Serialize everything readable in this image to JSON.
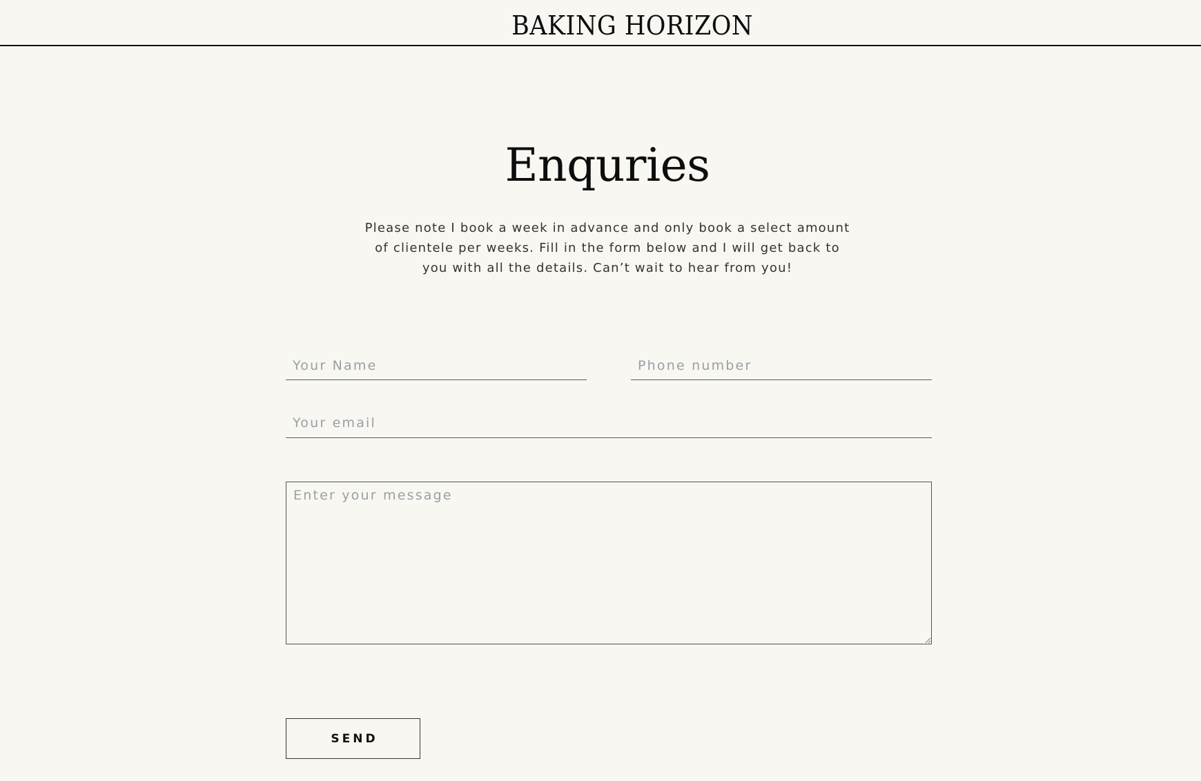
{
  "header": {
    "logo_text": "BAKING HORIZON"
  },
  "main": {
    "title": "Enquries",
    "intro_lines": [
      "Please note I book a week in advance and only book a select amount",
      "of clientele per weeks. Fill in the form below and I will get back to",
      "you with all the details. Can’t wait to hear from you!"
    ]
  },
  "form": {
    "name": {
      "value": "",
      "placeholder": "Your Name"
    },
    "phone": {
      "value": "",
      "placeholder": "Phone number"
    },
    "email": {
      "value": "",
      "placeholder": "Your email"
    },
    "message": {
      "value": "",
      "placeholder": "Enter your message"
    },
    "submit_label": "SEND"
  }
}
